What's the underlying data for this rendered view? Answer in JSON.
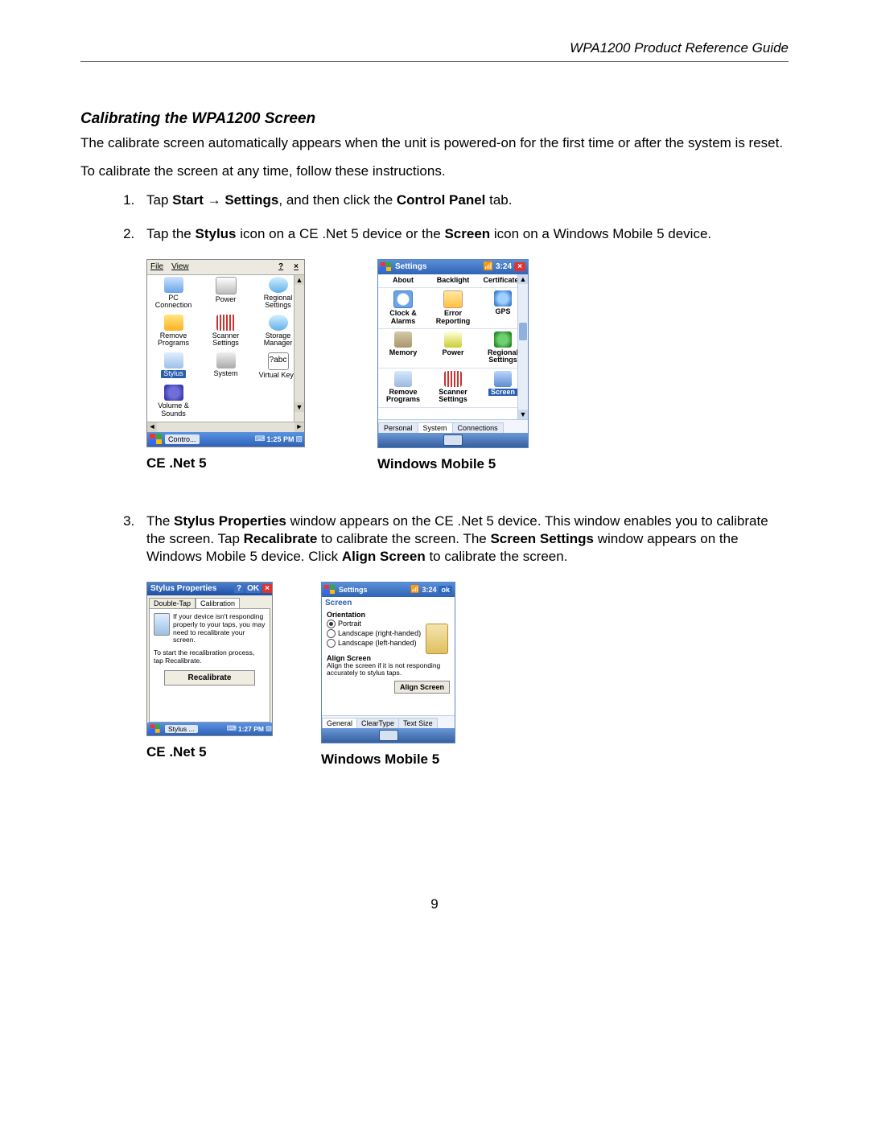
{
  "header": {
    "title": "WPA1200 Product Reference Guide"
  },
  "section": {
    "title": "Calibrating the WPA1200 Screen"
  },
  "para1": "The calibrate screen automatically appears when the unit is powered-on for the first time or after the system is reset.",
  "para2": "To calibrate the screen at any time, follow these instructions.",
  "step1": {
    "pre": "Tap ",
    "b1": "Start",
    "arrow": " → ",
    "b2": "Settings",
    "mid": ", and then click the ",
    "b3": "Control Panel",
    "post": " tab."
  },
  "step2": {
    "pre": "Tap the ",
    "b1": "Stylus",
    "mid": " icon on a CE .Net 5 device or the ",
    "b2": "Screen",
    "post": " icon on a Windows Mobile 5 device."
  },
  "step3": {
    "pre": "The ",
    "b1": "Stylus Properties",
    "t1": " window appears on the CE .Net 5 device. This window enables you to calibrate the screen. Tap ",
    "b2": "Recalibrate",
    "t2": " to calibrate the screen.  The ",
    "b3": "Screen Settings",
    "t3": " window appears on the Windows Mobile 5 device.  Click ",
    "b4": "Align Screen",
    "t4": " to calibrate the screen."
  },
  "captions": {
    "ce": "CE .Net 5",
    "wm": "Windows Mobile 5"
  },
  "ce": {
    "menu": {
      "file": "File",
      "view": "View",
      "help": "?",
      "close": "×"
    },
    "items": [
      {
        "name": "pc-connection",
        "label1": "PC",
        "label2": "Connection",
        "cls": "ice-pc"
      },
      {
        "name": "power",
        "label1": "Power",
        "label2": "",
        "cls": "ice-power"
      },
      {
        "name": "regional-settings",
        "label1": "Regional",
        "label2": "Settings",
        "cls": "ice-reg"
      },
      {
        "name": "remove-programs",
        "label1": "Remove",
        "label2": "Programs",
        "cls": "ice-rem"
      },
      {
        "name": "scanner-settings",
        "label1": "Scanner",
        "label2": "Settings",
        "cls": "ice-scan"
      },
      {
        "name": "storage-manager",
        "label1": "Storage",
        "label2": "Manager",
        "cls": "ice-stor"
      },
      {
        "name": "stylus",
        "label1": "Stylus",
        "label2": "",
        "cls": "ice-stylus",
        "selected": true
      },
      {
        "name": "system",
        "label1": "System",
        "label2": "",
        "cls": "ice-sys"
      },
      {
        "name": "virtual-keys",
        "label1": "Virtual Keys",
        "label2": "",
        "cls": "ice-vk",
        "text": "?abc"
      },
      {
        "name": "volume-sounds",
        "label1": "Volume &",
        "label2": "Sounds",
        "cls": "ice-vol"
      }
    ],
    "taskbar": {
      "btn": "Contro...",
      "clock": "1:25 PM"
    }
  },
  "wm": {
    "title": "Settings",
    "clock": "3:24",
    "rows": [
      [
        {
          "name": "about",
          "label1": "About",
          "label2": ""
        },
        {
          "name": "backlight",
          "label1": "Backlight",
          "label2": ""
        },
        {
          "name": "certificates",
          "label1": "Certificates",
          "label2": ""
        }
      ],
      [
        {
          "name": "clock-alarms",
          "label1": "Clock &",
          "label2": "Alarms",
          "cls": "wi-clock"
        },
        {
          "name": "error-reporting",
          "label1": "Error",
          "label2": "Reporting",
          "cls": "wi-err"
        },
        {
          "name": "gps",
          "label1": "GPS",
          "label2": "",
          "cls": "wi-gps"
        }
      ],
      [
        {
          "name": "memory",
          "label1": "Memory",
          "label2": "",
          "cls": "wi-mem"
        },
        {
          "name": "power",
          "label1": "Power",
          "label2": "",
          "cls": "wi-pow"
        },
        {
          "name": "regional-settings",
          "label1": "Regional",
          "label2": "Settings",
          "cls": "wi-reg"
        }
      ],
      [
        {
          "name": "remove-programs",
          "label1": "Remove",
          "label2": "Programs",
          "cls": "wi-rem"
        },
        {
          "name": "scanner-settings",
          "label1": "Scanner",
          "label2": "Settings",
          "cls": "wi-scan"
        },
        {
          "name": "screen",
          "label1": "Screen",
          "label2": "",
          "cls": "wi-scr",
          "selected": true
        }
      ]
    ],
    "tabs": {
      "personal": "Personal",
      "system": "System",
      "connections": "Connections"
    }
  },
  "stylus": {
    "title": "Stylus Properties",
    "tabs": {
      "dtap": "Double-Tap",
      "cal": "Calibration"
    },
    "note": "If your device isn't responding properly to your taps, you may need to recalibrate your screen.",
    "hint": "To start the recalibration process, tap Recalibrate.",
    "btn": "Recalibrate",
    "task": {
      "btn": "Stylus ...",
      "clock": "1:27 PM"
    }
  },
  "screen": {
    "title": "Settings",
    "clock": "3:24",
    "ok": "ok",
    "sub": "Screen",
    "orient_lbl": "Orientation",
    "radios": {
      "portrait": "Portrait",
      "land_r": "Landscape (right-handed)",
      "land_l": "Landscape (left-handed)"
    },
    "align_lbl": "Align Screen",
    "align_help": "Align the screen if it is not responding accurately to stylus taps.",
    "align_btn": "Align Screen",
    "tabs": {
      "general": "General",
      "cleartype": "ClearType",
      "textsize": "Text Size"
    }
  },
  "page_number": "9"
}
